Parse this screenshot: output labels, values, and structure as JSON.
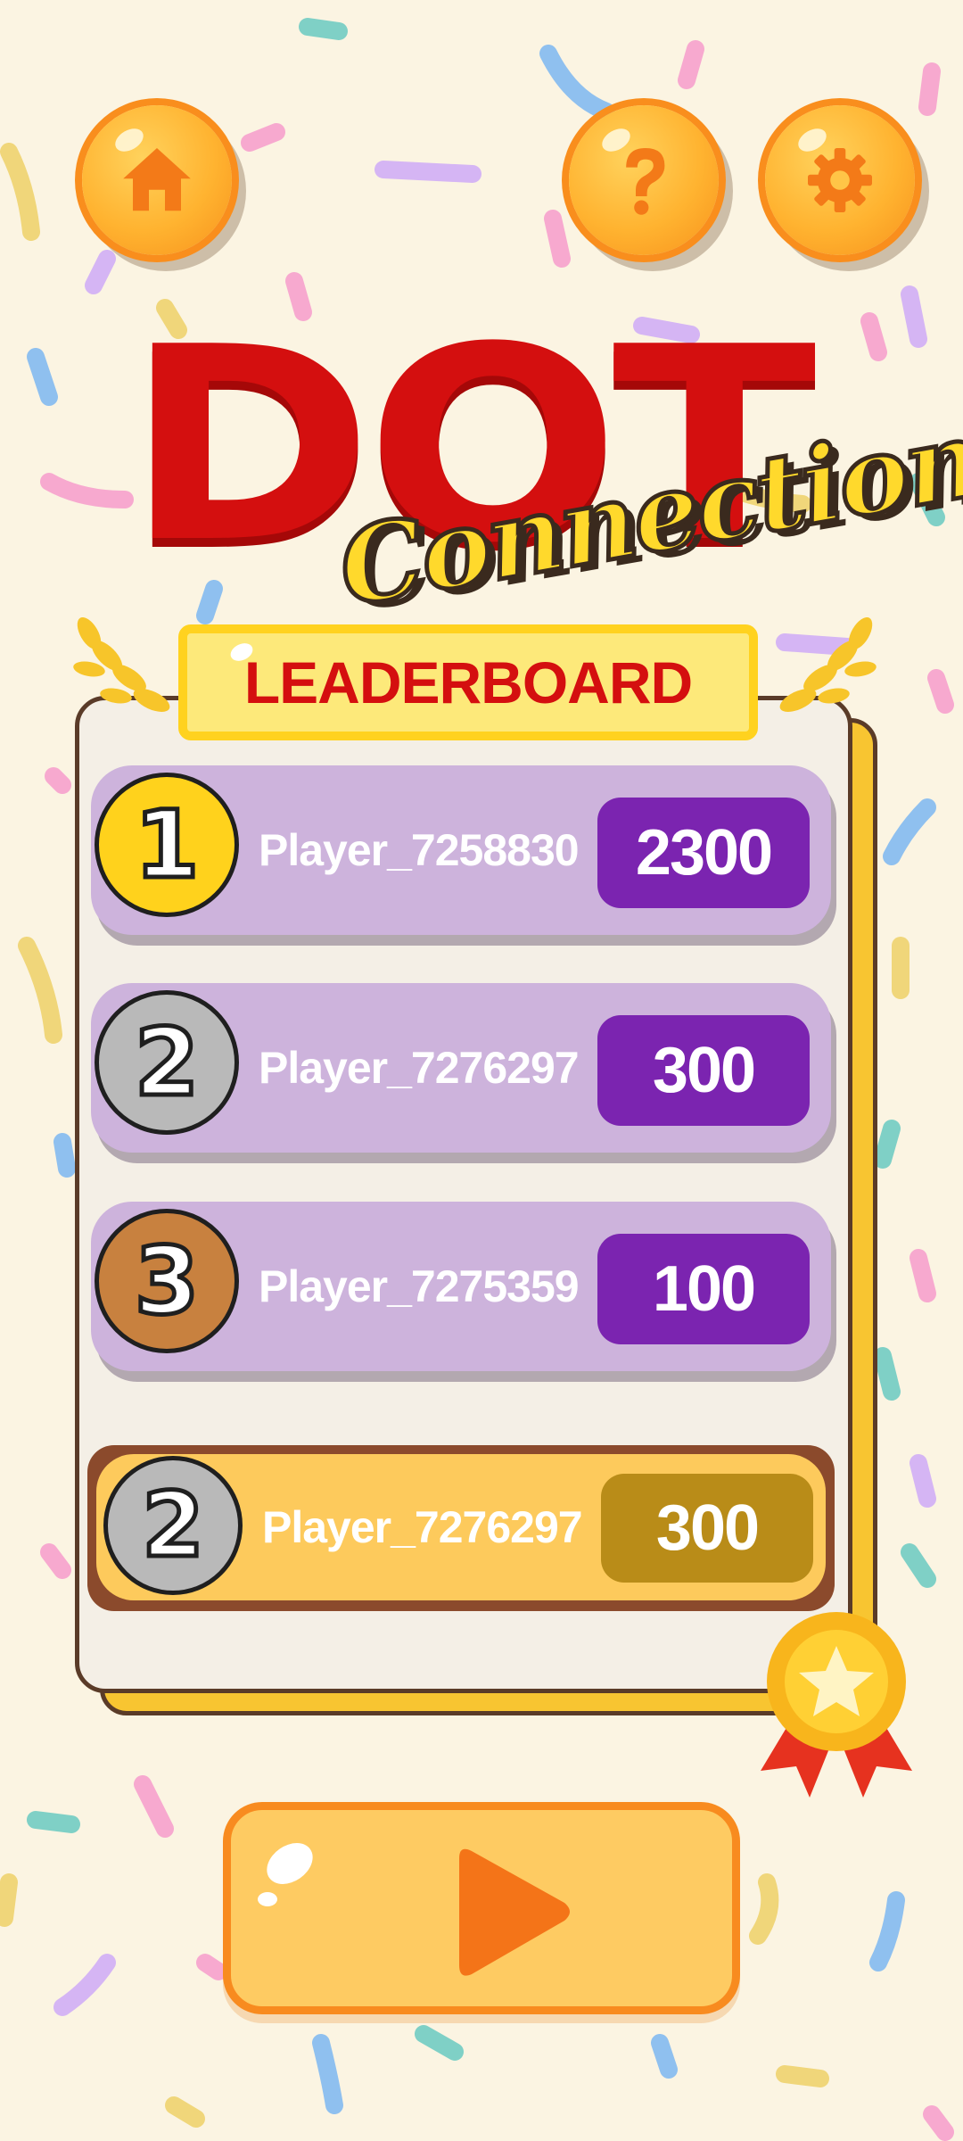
{
  "header": {
    "home_icon": "home-icon",
    "help_icon": "question-mark-icon",
    "settings_icon": "gear-icon"
  },
  "title": {
    "line1": "DOT",
    "line2": "Connection"
  },
  "leaderboard": {
    "heading": "LEADERBOARD",
    "entries": [
      {
        "rank": "1",
        "player": "Player_7258830",
        "score": "2300",
        "medal_color": "#ffd21c"
      },
      {
        "rank": "2",
        "player": "Player_7276297",
        "score": "300",
        "medal_color": "#b9b9b9"
      },
      {
        "rank": "3",
        "player": "Player_7275359",
        "score": "100",
        "medal_color": "#c8813f"
      }
    ],
    "current_player": {
      "rank": "2",
      "player": "Player_7276297",
      "score": "300"
    }
  },
  "play_button": {
    "icon": "play-icon"
  },
  "colors": {
    "background": "#fbf4e2",
    "title_red": "#d40f0f",
    "title_yellow": "#ffd92c",
    "score_purple": "#7b24b0",
    "row_lilac": "#cdb3dc",
    "button_orange": "#f88b1f"
  }
}
